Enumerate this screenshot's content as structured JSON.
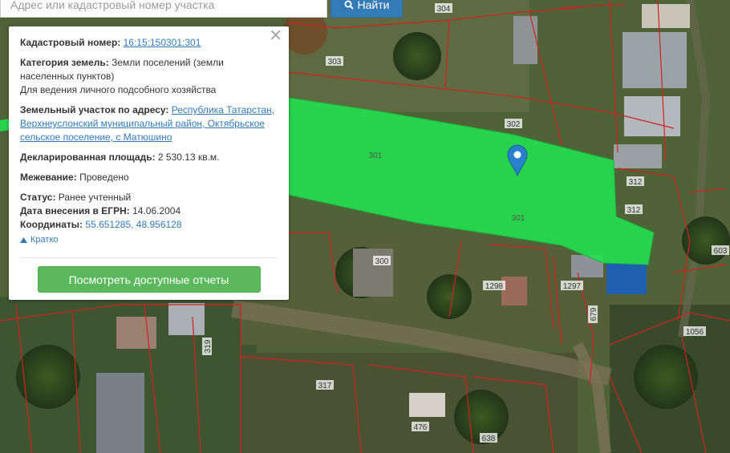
{
  "search": {
    "placeholder": "Адрес или кадастровый номер участка",
    "button_label": "Найти"
  },
  "info_panel": {
    "cadastral_label": "Кадастровый номер:",
    "cadastral_value": "16:15:150301:301",
    "category_label": "Категория земель:",
    "category_value": "Земли поселений (земли населенных пунктов)",
    "usage_value": "Для ведения личного подсобного хозяйства",
    "address_label": "Земельный участок по адресу:",
    "address_value": "Республика Татарстан, Верхнеуслонский муниципальный район, Октябрьское сельское поселение, с Матюшино",
    "area_label": "Декларированная площадь:",
    "area_value": "2 530.13 кв.м.",
    "survey_label": "Межевание:",
    "survey_value": "Проведено",
    "status_label": "Статус:",
    "status_value": "Ранее учтенный",
    "date_label": "Дата внесения в ЕГРН:",
    "date_value": "14.06.2004",
    "coords_label": "Координаты:",
    "coords_value": "55.651285, 48.956128",
    "collapse_label": "Кратко",
    "reports_button": "Посмотреть доступные отчеты"
  },
  "map": {
    "highlight_color": "#22e04f",
    "boundary_color": "#d42020",
    "marker_color": "#2a81cb",
    "parcel_labels": [
      "304",
      "303",
      "302",
      "301",
      "301",
      "312",
      "312",
      "300",
      "1298",
      "1297",
      "679",
      "603",
      "1056",
      "319",
      "317",
      "476",
      "638"
    ]
  }
}
